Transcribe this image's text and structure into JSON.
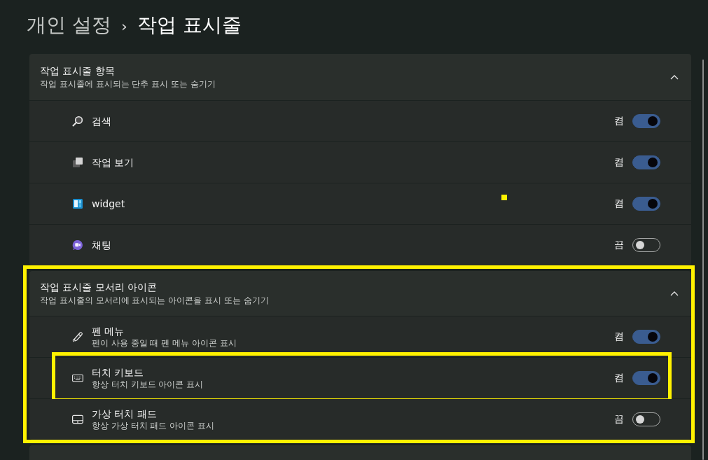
{
  "breadcrumb": {
    "parent": "개인 설정",
    "separator": "›",
    "current": "작업 표시줄"
  },
  "sections": [
    {
      "title": "작업 표시줄 항목",
      "subtitle": "작업 표시줄에 표시되는 단추 표시 또는 숨기기",
      "expanded": true,
      "highlighted": false,
      "items": [
        {
          "label": "검색",
          "state_label": "켬",
          "on": true,
          "highlighted": false,
          "marker": false
        },
        {
          "label": "작업 보기",
          "state_label": "켬",
          "on": true,
          "highlighted": false,
          "marker": false
        },
        {
          "label": "widget",
          "state_label": "켬",
          "on": true,
          "highlighted": false,
          "marker": true
        },
        {
          "label": "채팅",
          "state_label": "끔",
          "on": false,
          "highlighted": false,
          "marker": false
        }
      ]
    },
    {
      "title": "작업 표시줄 모서리 아이콘",
      "subtitle": "작업 표시줄의 모서리에 표시되는 아이콘을 표시 또는 숨기기",
      "expanded": true,
      "highlighted": true,
      "items": [
        {
          "label": "펜 메뉴",
          "description": "펜이 사용 중일 때 펜 메뉴 아이콘 표시",
          "state_label": "켬",
          "on": true,
          "highlighted": false,
          "marker": false
        },
        {
          "label": "터치 키보드",
          "description": "항상 터치 키보드 아이콘 표시",
          "state_label": "켬",
          "on": true,
          "highlighted": true,
          "marker": false
        },
        {
          "label": "가상 터치 패드",
          "description": "항상 가상 터치 패드 아이콘 표시",
          "state_label": "끔",
          "on": false,
          "highlighted": false,
          "marker": false
        }
      ]
    }
  ],
  "next_section_peek": true
}
